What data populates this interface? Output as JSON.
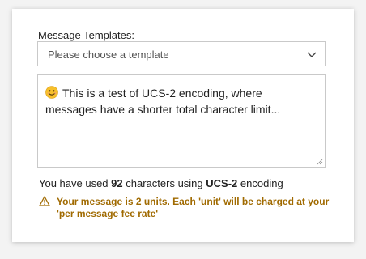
{
  "form": {
    "templates_label": "Message Templates:",
    "templates_select": {
      "placeholder": "Please choose a template",
      "icon": "chevron-down-icon"
    },
    "message": {
      "emoji": "smiling-face-emoji",
      "text": "This is a test of UCS-2 encoding, where messages have a shorter total character limit..."
    }
  },
  "usage": {
    "prefix": "You have used",
    "count": "92",
    "middle": "characters using",
    "encoding": "UCS-2",
    "suffix": "encoding"
  },
  "warning": {
    "icon": "warning-icon",
    "text": "Your message is 2 units. Each 'unit' will be charged at your 'per message fee rate'",
    "color": "#a06a00"
  }
}
